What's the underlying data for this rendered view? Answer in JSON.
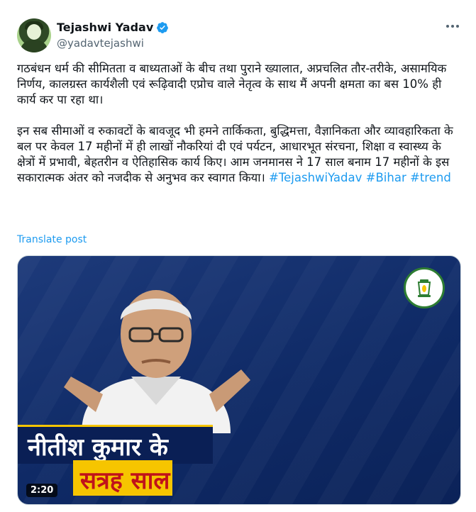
{
  "author": {
    "name": "Tejashwi Yadav",
    "handle": "@yadavtejashwi"
  },
  "tweet": {
    "paragraph1": "गठबंधन धर्म की सीमितता व बाध्यताओं के बीच तथा पुराने ख्यालात, अप्रचलित तौर-तरीके, असामयिक निर्णय, कालग्रस्त कार्यशैली एवं रूढ़िवादी एप्रोच वाले नेतृत्व के साथ मैं अपनी क्षमता का बस 10% ही कार्य कर पा रहा था।",
    "paragraph2": "इन सब सीमाओं व रुकावटों के बावजूद भी हमने तार्किकता, बुद्धिमत्ता, वैज्ञानिकता और व्यावहारिकता के बल पर केवल 17 महीनों में ही लाखों नौकरियां दी एवं पर्यटन, आधारभूत संरचना, शिक्षा व स्वास्थ्य के क्षेत्रों में प्रभावी, बेहतरीन व ऐतिहासिक कार्य किए। आम जनमानस ने 17 साल बनाम 17 महीनों के इस सकारात्मक अंतर को नजदीक से अनुभव कर स्वागत किया।",
    "hashtags": [
      "#TejashwiYadav",
      "#Bihar",
      "#trend"
    ],
    "translate_label": "Translate post"
  },
  "media": {
    "caption_line1": "नीतीश कुमार के",
    "caption_line2": "सत्रह साल",
    "duration": "2:20"
  },
  "colors": {
    "accent": "#1d9bf0",
    "verified": "#1d9bf0",
    "caption_bg": "#0a1f55",
    "caption_highlight": "#f6c500",
    "caption_red": "#c0121a"
  },
  "icons": {
    "more": "more-icon",
    "verified": "verified-badge-icon"
  }
}
